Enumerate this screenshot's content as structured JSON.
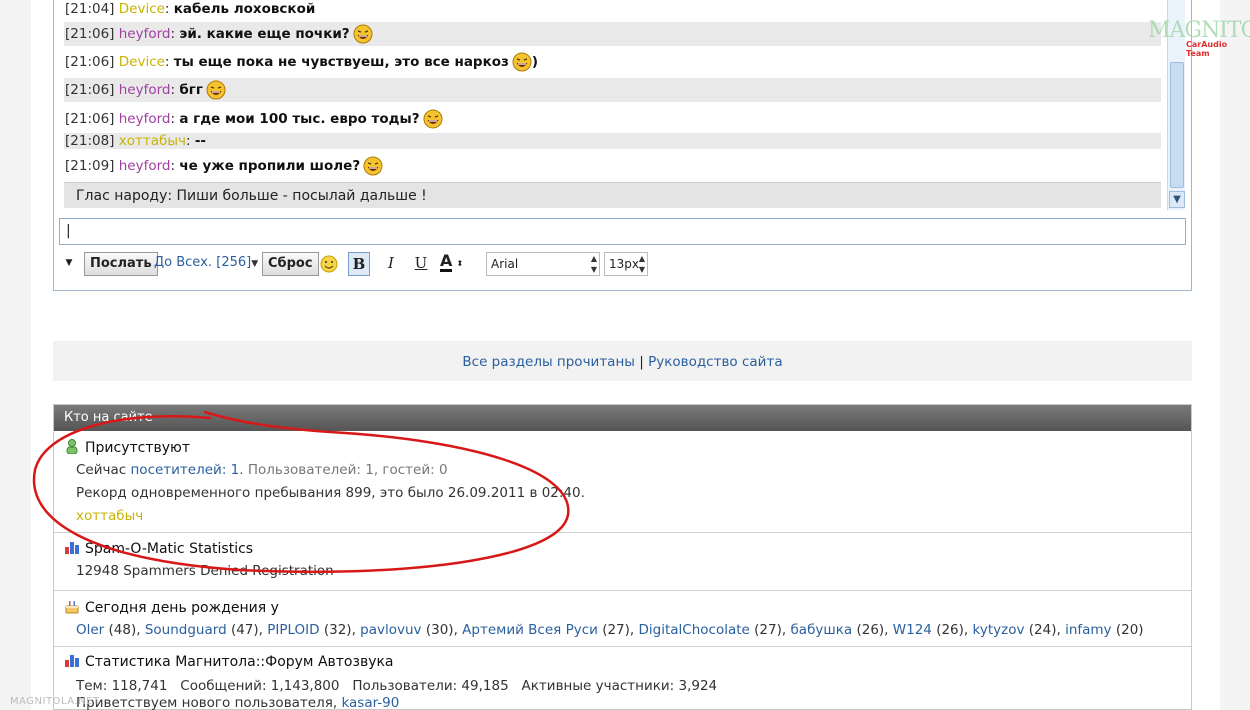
{
  "chat": {
    "messages": [
      {
        "time": "[21:04]",
        "user": "Device",
        "text": "кабель лоховской",
        "smile": false
      },
      {
        "time": "[21:06]",
        "user": "heyford",
        "text": "эй. какие еще почки?",
        "smile": true
      },
      {
        "time": "[21:06]",
        "user": "Device",
        "text": "ты еще пока не чувствуеш, это все наркоз",
        "smile": true,
        "after": ")"
      },
      {
        "time": "[21:06]",
        "user": "heyford",
        "text": "бгг",
        "smile": true
      },
      {
        "time": "[21:06]",
        "user": "heyford",
        "text": "а где мои 100 тыс. евро тоды?",
        "smile": true
      },
      {
        "time": "[21:08]",
        "user": "хоттабыч",
        "text": "--",
        "smile": false
      },
      {
        "time": "[21:09]",
        "user": "heyford",
        "text": "че уже пропили шоле?",
        "smile": true
      }
    ],
    "announcement": "Глас народу: Пиши больше - посылай дальше !",
    "input_value": "|",
    "toolbar": {
      "send": "Послать",
      "to_all": "До Всех.",
      "count": "[256]",
      "reset": "Сброс",
      "bold": "B",
      "italic": "I",
      "underline": "U",
      "color": "A",
      "font": "Arial",
      "size": "13px"
    }
  },
  "links": {
    "all_read": "Все разделы прочитаны",
    "separator": "|",
    "guide": "Руководство сайта"
  },
  "online": {
    "header": "Кто на сайте",
    "present": {
      "title": "Присутствуют",
      "now": "Сейчас",
      "visitors": "посетителей: 1.",
      "users_guests": "Пользователей: 1, гостей: 0",
      "record": "Рекорд одновременного пребывания 899, это было 26.09.2011 в 02:40.",
      "user": "хоттабыч"
    },
    "spam": {
      "title": "Spam-O-Matic Statistics",
      "text": "12948 Spammers Denied Registration"
    },
    "birthday": {
      "title": "Сегодня день рождения у",
      "people": [
        {
          "name": "Oler",
          "age": "(48),"
        },
        {
          "name": "Soundguard",
          "age": "(47),"
        },
        {
          "name": "PIPLOID",
          "age": "(32),"
        },
        {
          "name": "pavlovuv",
          "age": "(30),"
        },
        {
          "name": "Артемий Всея Руси",
          "age": "(27),"
        },
        {
          "name": "DigitalChocolate",
          "age": "(27),"
        },
        {
          "name": "бабушка",
          "age": "(26),"
        },
        {
          "name": "W124",
          "age": "(26),"
        },
        {
          "name": "kytyzov",
          "age": "(24),"
        },
        {
          "name": "infamy",
          "age": "(20)"
        }
      ]
    },
    "stats": {
      "title": "Статистика Магнитола::Форум Автозвука",
      "line": "Тем: 118,741   Сообщений: 1,143,800   Пользователи: 49,185   Активные участники: 3,924",
      "welcome": "Приветствуем нового пользователя,",
      "new_user": "kasar-90"
    }
  },
  "watermark": {
    "logo": "MAGNITOLA",
    "sub": "CarAudio Team",
    "bottom": "MAGNITOLA.NET"
  },
  "colors": {
    "accent_link": "#2a5f9e",
    "highlight_user": "#c8b400",
    "heyford": "#a040a0",
    "annotation_circle": "#d81818"
  }
}
